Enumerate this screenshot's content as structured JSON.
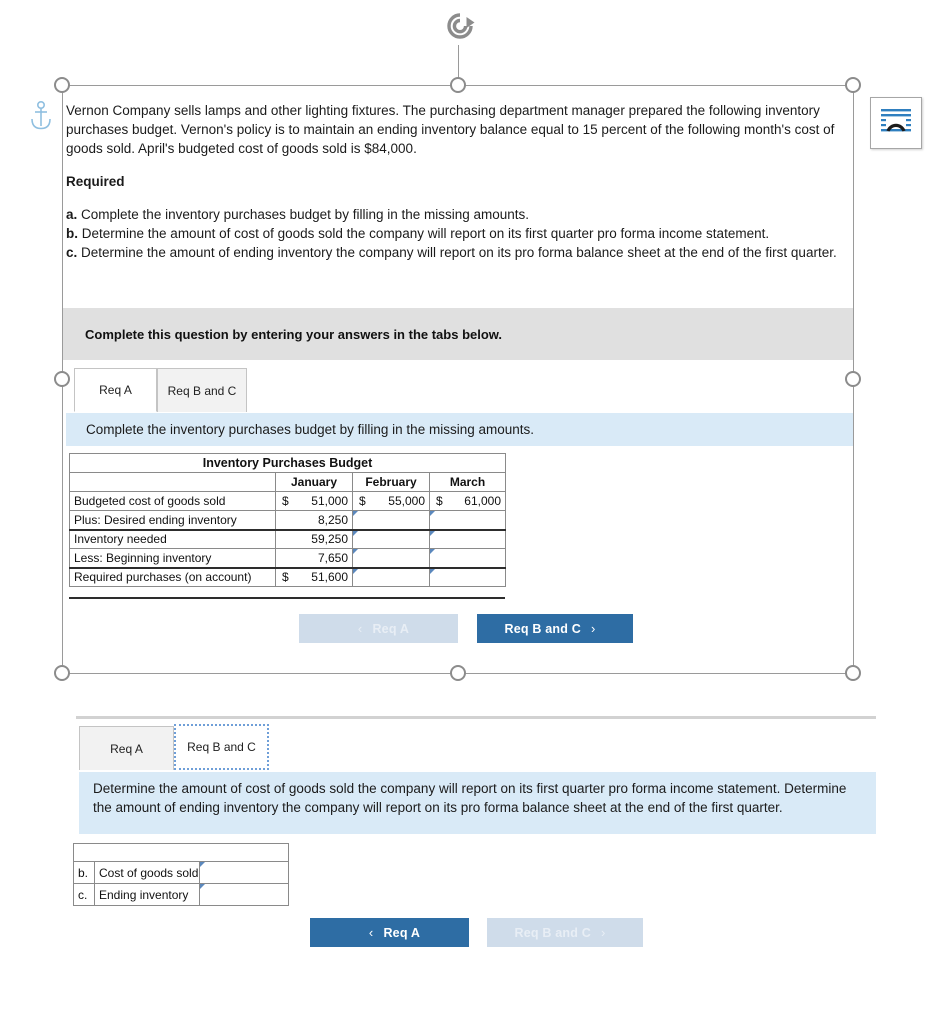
{
  "document": {
    "selection": {
      "rotate_icon": "rotate-icon",
      "anchor_icon": "anchor-icon",
      "layout_options_icon": "text-wrapping-icon"
    }
  },
  "upper": {
    "problem": {
      "paragraph": "Vernon Company sells lamps and other lighting fixtures. The purchasing department manager prepared the following inventory purchases budget. Vernon's policy is to maintain an ending inventory balance equal to 15 percent of the following month's cost of goods sold. April's budgeted cost of goods sold is $84,000.",
      "required_heading": "Required",
      "items": [
        {
          "marker": "a.",
          "text": "Complete the inventory purchases budget by filling in the missing amounts."
        },
        {
          "marker": "b.",
          "text": "Determine the amount of cost of goods sold the company will report on its first quarter pro forma income statement."
        },
        {
          "marker": "c.",
          "text": "Determine the amount of ending inventory the company will report on its pro forma balance sheet at the end of the first quarter."
        }
      ]
    },
    "banner": "Complete this question by entering your answers in the tabs below.",
    "tabs": [
      {
        "label": "Req A",
        "state": "active"
      },
      {
        "label": "Req B and C",
        "state": "inactive"
      }
    ],
    "instruction": "Complete the inventory purchases budget by filling in the missing amounts.",
    "table": {
      "title": "Inventory Purchases Budget",
      "columns": [
        "",
        "January",
        "February",
        "March"
      ],
      "rows": [
        {
          "label": "Budgeted cost of goods sold",
          "january": {
            "dollar": "$",
            "value": "51,000"
          },
          "february": {
            "dollar": "$",
            "value": "55,000"
          },
          "march": {
            "dollar": "$",
            "value": "61,000"
          }
        },
        {
          "label": "Plus: Desired ending inventory",
          "january": {
            "dollar": "",
            "value": "8,250"
          },
          "february": {
            "dollar": "",
            "value": ""
          },
          "march": {
            "dollar": "",
            "value": ""
          }
        },
        {
          "label": "Inventory needed",
          "january": {
            "dollar": "",
            "value": "59,250"
          },
          "february": {
            "dollar": "",
            "value": ""
          },
          "march": {
            "dollar": "",
            "value": ""
          }
        },
        {
          "label": "Less: Beginning inventory",
          "january": {
            "dollar": "",
            "value": "7,650"
          },
          "february": {
            "dollar": "",
            "value": ""
          },
          "march": {
            "dollar": "",
            "value": ""
          }
        },
        {
          "label": "Required purchases (on account)",
          "january": {
            "dollar": "$",
            "value": "51,600"
          },
          "february": {
            "dollar": "",
            "value": ""
          },
          "march": {
            "dollar": "",
            "value": ""
          }
        }
      ]
    },
    "nav": {
      "prev": {
        "label": "Req A",
        "chevron": "‹",
        "state": "disabled"
      },
      "next": {
        "label": "Req B and C",
        "chevron": "›",
        "state": "primary"
      }
    }
  },
  "lower": {
    "tabs": [
      {
        "label": "Req A",
        "state": "inactive"
      },
      {
        "label": "Req B and C",
        "state": "active-focused"
      }
    ],
    "instruction": "Determine the amount of cost of goods sold the company will report on its first quarter pro forma income statement. Determine the amount of ending inventory the company will report on its pro forma balance sheet at the end of the first quarter.",
    "table": {
      "header": "",
      "rows": [
        {
          "marker": "b.",
          "label": "Cost of goods sold",
          "value": ""
        },
        {
          "marker": "c.",
          "label": "Ending inventory",
          "value": ""
        }
      ]
    },
    "nav": {
      "prev": {
        "label": "Req A",
        "chevron": "‹",
        "state": "primary"
      },
      "next": {
        "label": "Req B and C",
        "chevron": "›",
        "state": "disabled"
      }
    }
  },
  "colors": {
    "table_header_blue": "#72aadd",
    "instruction_blue": "#d9eaf7",
    "banner_gray": "#e0e0e0",
    "button_primary": "#2e6da4",
    "button_disabled": "#cfdcea",
    "input_border": "#5b88bd"
  }
}
